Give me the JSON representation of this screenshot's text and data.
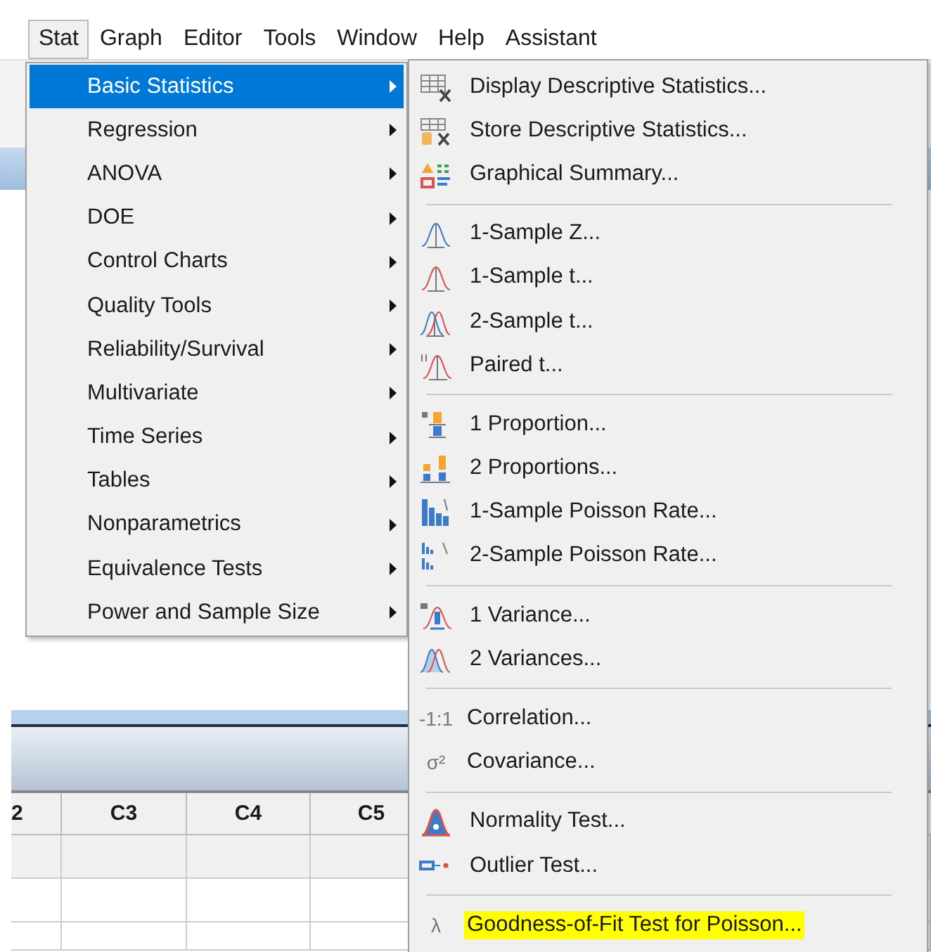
{
  "menubar": [
    {
      "label": "Stat",
      "selected": true
    },
    {
      "label": "Graph",
      "selected": false
    },
    {
      "label": "Editor",
      "selected": false
    },
    {
      "label": "Tools",
      "selected": false
    },
    {
      "label": "Window",
      "selected": false
    },
    {
      "label": "Help",
      "selected": false
    },
    {
      "label": "Assistant",
      "selected": false
    }
  ],
  "stat_menu": [
    {
      "label": "Basic Statistics",
      "selected": true
    },
    {
      "label": "Regression",
      "selected": false
    },
    {
      "label": "ANOVA",
      "selected": false
    },
    {
      "label": "DOE",
      "selected": false
    },
    {
      "label": "Control Charts",
      "selected": false
    },
    {
      "label": "Quality Tools",
      "selected": false
    },
    {
      "label": "Reliability/Survival",
      "selected": false
    },
    {
      "label": "Multivariate",
      "selected": false
    },
    {
      "label": "Time Series",
      "selected": false
    },
    {
      "label": "Tables",
      "selected": false
    },
    {
      "label": "Nonparametrics",
      "selected": false
    },
    {
      "label": "Equivalence Tests",
      "selected": false
    },
    {
      "label": "Power and Sample Size",
      "selected": false
    }
  ],
  "basic_statistics_menu": [
    {
      "kind": "item",
      "label": "Display Descriptive Statistics...",
      "highlighted": false
    },
    {
      "kind": "item",
      "label": "Store Descriptive Statistics...",
      "highlighted": false
    },
    {
      "kind": "item",
      "label": "Graphical Summary...",
      "highlighted": false
    },
    {
      "kind": "separator"
    },
    {
      "kind": "item",
      "label": "1-Sample Z...",
      "highlighted": false
    },
    {
      "kind": "item",
      "label": "1-Sample t...",
      "highlighted": false
    },
    {
      "kind": "item",
      "label": "2-Sample t...",
      "highlighted": false
    },
    {
      "kind": "item",
      "label": "Paired t...",
      "highlighted": false
    },
    {
      "kind": "separator"
    },
    {
      "kind": "item",
      "label": "1 Proportion...",
      "highlighted": false
    },
    {
      "kind": "item",
      "label": "2 Proportions...",
      "highlighted": false
    },
    {
      "kind": "item",
      "label": "1-Sample Poisson Rate...",
      "highlighted": false
    },
    {
      "kind": "item",
      "label": "2-Sample Poisson Rate...",
      "highlighted": false
    },
    {
      "kind": "separator"
    },
    {
      "kind": "item",
      "label": "1 Variance...",
      "highlighted": false
    },
    {
      "kind": "item",
      "label": "2 Variances...",
      "highlighted": false
    },
    {
      "kind": "separator"
    },
    {
      "kind": "item",
      "label": "Correlation...",
      "icon_text": "-1:1",
      "highlighted": false
    },
    {
      "kind": "item",
      "label": "Covariance...",
      "icon_text": "σ²",
      "highlighted": false
    },
    {
      "kind": "separator"
    },
    {
      "kind": "item",
      "label": "Normality Test...",
      "highlighted": false
    },
    {
      "kind": "item",
      "label": "Outlier Test...",
      "highlighted": false
    },
    {
      "kind": "separator"
    },
    {
      "kind": "item",
      "label": "Goodness-of-Fit Test for Poisson...",
      "icon_text": "λ",
      "highlighted": true
    }
  ],
  "worksheet": {
    "columns": [
      "2",
      "C3",
      "C4",
      "C5"
    ]
  }
}
